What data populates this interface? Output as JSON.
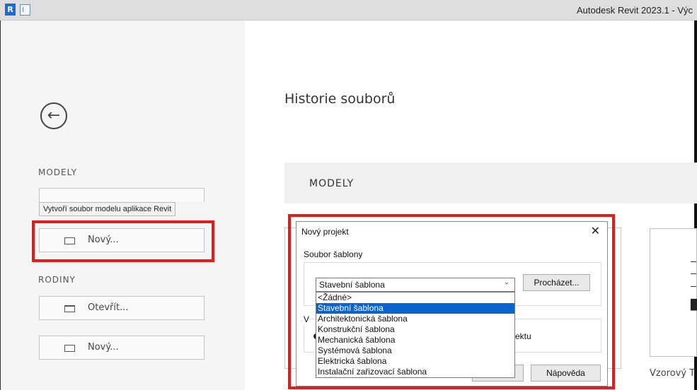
{
  "titlebar": {
    "logo": "R",
    "title": "Autodesk Revit 2023.1 - Výc"
  },
  "sidebar": {
    "models_heading": "MODELY",
    "tooltip": "Vytvoří soubor modelu aplikace Revit",
    "new_model_label": "Nový...",
    "families_heading": "RODINY",
    "open_family_label": "Otevřít...",
    "new_family_label": "Nový..."
  },
  "main": {
    "title": "Historie souborů",
    "section_label": "MODELY",
    "sample_caption": "Vzorový T"
  },
  "dialog": {
    "title": "Nový projekt",
    "close_glyph": "✕",
    "template_group_label": "Soubor šablony",
    "selected_template": "Stavební šablona",
    "browse_label": "Procházet...",
    "options": [
      "<Žádné>",
      "Stavební šablona",
      "Architektonická šablona",
      "Konstrukční šablona",
      "Mechanická šablona",
      "Systémová šablona",
      "Elektrická šablona",
      "Instalační zařizovací šablona"
    ],
    "hidden_group_fragment": "V",
    "hidden_radio_fragment": "ektu",
    "help_label": "Nápověda"
  },
  "colors": {
    "highlight_box": "#e31b1b",
    "selection": "#0a64d0",
    "sidebar_bg": "#f5f5f5",
    "titlebar_bg": "#dedede"
  },
  "icons": [
    "revit-logo-icon",
    "quick-access-icon",
    "back-arrow-icon",
    "new-document-icon",
    "open-folder-icon",
    "close-icon",
    "chevron-down-icon",
    "template-preview-icon"
  ]
}
